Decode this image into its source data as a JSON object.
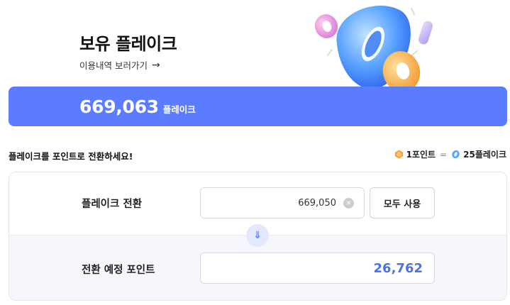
{
  "header": {
    "title": "보유 플레이크",
    "history_link": "이용내역 보러가기",
    "history_arrow": "→"
  },
  "balance": {
    "value": "669,063",
    "unit": "플레이크"
  },
  "conversion": {
    "message": "플레이크를 포인트로 전환하세요!",
    "rate_point": "1포인트",
    "rate_eq": "=",
    "rate_flake": "25플레이크"
  },
  "form": {
    "convert_label": "플레이크 전환",
    "convert_value": "669,050",
    "clear_icon": "×",
    "use_all_label": "모두 사용",
    "arrow_icon": "⇓",
    "expected_label": "전환 예정 포인트",
    "expected_value": "26,762"
  },
  "colors": {
    "accent": "#5b7cff",
    "point_blue": "#4b72ee",
    "coin_orange": "#f4a23c"
  }
}
